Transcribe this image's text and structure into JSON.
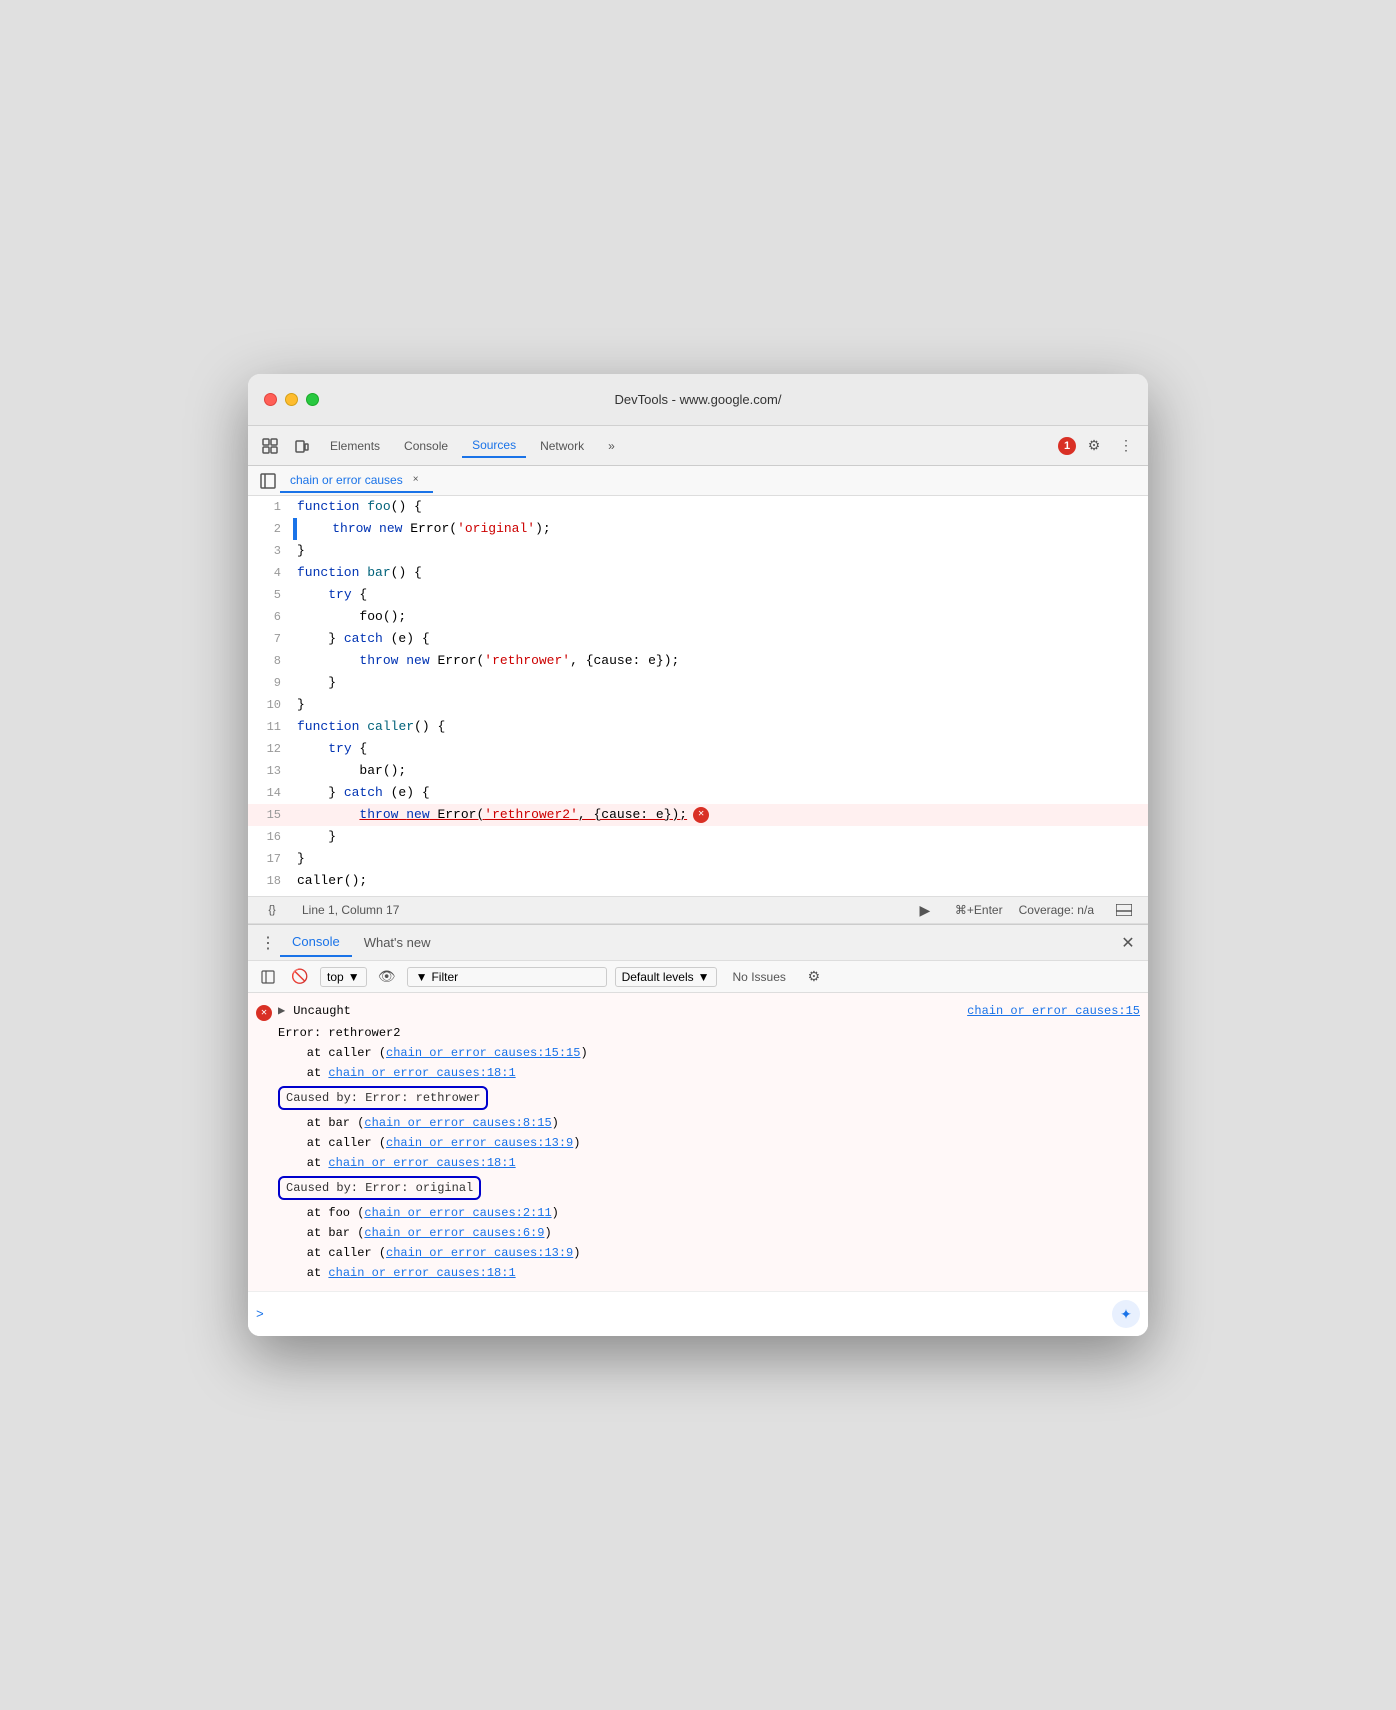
{
  "window": {
    "title": "DevTools - www.google.com/"
  },
  "nav": {
    "tabs": [
      {
        "label": "Elements",
        "active": false
      },
      {
        "label": "Console",
        "active": false
      },
      {
        "label": "Sources",
        "active": true
      },
      {
        "label": "Network",
        "active": false
      },
      {
        "label": "»",
        "active": false
      }
    ],
    "error_count": "1"
  },
  "file_tab": {
    "name": "chain or error causes",
    "close_label": "×"
  },
  "code": {
    "lines": [
      {
        "num": 1,
        "content": "function foo() {"
      },
      {
        "num": 2,
        "content": "    throw new Error('original');"
      },
      {
        "num": 3,
        "content": "}"
      },
      {
        "num": 4,
        "content": "function bar() {"
      },
      {
        "num": 5,
        "content": "    try {"
      },
      {
        "num": 6,
        "content": "        foo();"
      },
      {
        "num": 7,
        "content": "    } catch (e) {"
      },
      {
        "num": 8,
        "content": "        throw new Error('rethrower', {cause: e});"
      },
      {
        "num": 9,
        "content": "    }"
      },
      {
        "num": 10,
        "content": "}"
      },
      {
        "num": 11,
        "content": "function caller() {"
      },
      {
        "num": 12,
        "content": "    try {"
      },
      {
        "num": 13,
        "content": "        bar();"
      },
      {
        "num": 14,
        "content": "    } catch (e) {"
      },
      {
        "num": 15,
        "content": "        throw new Error('rethrower2', {cause: e});",
        "error": true
      },
      {
        "num": 16,
        "content": "    }"
      },
      {
        "num": 17,
        "content": "}"
      },
      {
        "num": 18,
        "content": "caller();"
      }
    ]
  },
  "status_bar": {
    "braces": "{}",
    "position": "Line 1, Column 17",
    "run_label": "⌘+Enter",
    "coverage": "Coverage: n/a"
  },
  "console": {
    "tabs": [
      {
        "label": "Console",
        "active": true
      },
      {
        "label": "What's new",
        "active": false
      }
    ],
    "toolbar": {
      "context": "top",
      "filter_placeholder": "Filter",
      "levels": "Default levels",
      "no_issues": "No Issues"
    },
    "entries": [
      {
        "type": "error",
        "expand_arrow": "▶",
        "main": "Uncaught",
        "link": "chain or error causes:15",
        "lines": [
          "Error: rethrower2",
          "    at caller (chain or error causes:15:15)",
          "    at chain or error causes:18:1"
        ]
      },
      {
        "type": "caused-by",
        "label": "Caused by: Error: rethrower",
        "lines": [
          "    at bar (chain or error causes:8:15)",
          "    at caller (chain or error causes:13:9)",
          "    at chain or error causes:18:1"
        ]
      },
      {
        "type": "caused-by",
        "label": "Caused by: Error: original",
        "lines": [
          "    at foo (chain or error causes:2:11)",
          "    at bar (chain or error causes:6:9)",
          "    at caller (chain or error causes:13:9)",
          "    at chain or error causes:18:1"
        ]
      }
    ],
    "prompt": ">"
  }
}
